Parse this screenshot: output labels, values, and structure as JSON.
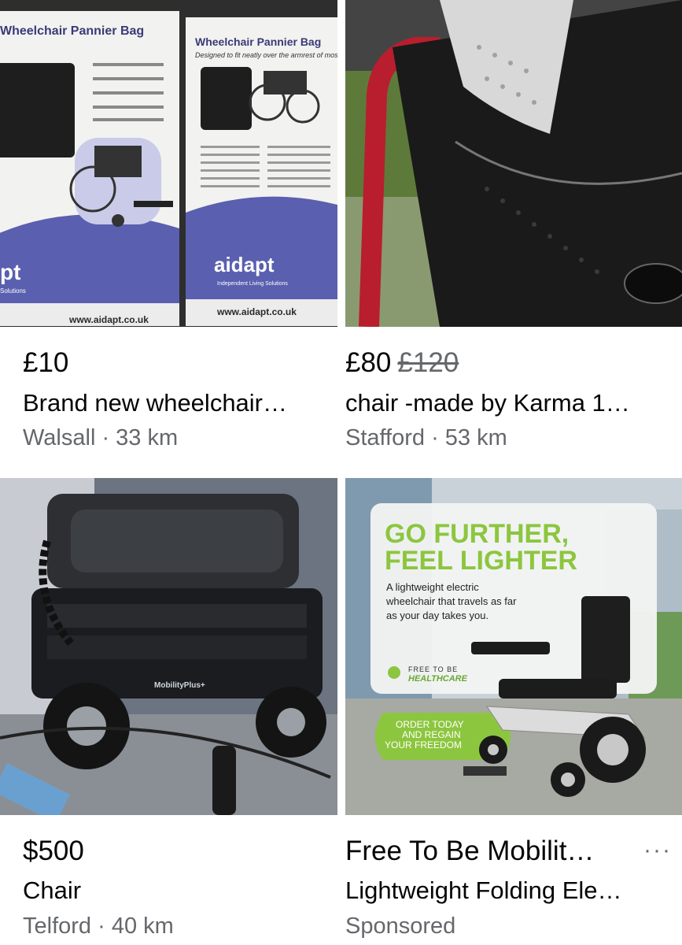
{
  "listings": [
    {
      "price": "£10",
      "title": "Brand new wheelchair…",
      "subtitle": "Walsall · 33 km",
      "box": {
        "heading": "Wheelchair Pannier Bag",
        "tagline": "Designed to fit neatly over the armrest of most wheelchairs",
        "brand": "aidapt",
        "brand_sub": "Independent Living Solutions",
        "url": "www.aidapt.co.uk",
        "partial_brand": "pt",
        "partial_sub": "Solutions"
      }
    },
    {
      "price": "£80",
      "old_price": "£120",
      "title": "chair -made by Karma 1…",
      "subtitle": "Stafford · 53 km"
    },
    {
      "price": "$500",
      "title": "Chair",
      "subtitle": "Telford · 40 km",
      "scooter_brand": "MobilityPlus+"
    },
    {
      "price": "Free To Be Mobilit…",
      "title": "Lightweight Folding Ele…",
      "subtitle": "Sponsored",
      "more": "···",
      "ad": {
        "headline_1": "GO FURTHER,",
        "headline_2": "FEEL LIGHTER",
        "body_1": "A lightweight electric",
        "body_2": "wheelchair that travels as far",
        "body_3": "as your day takes you.",
        "logo_1": "FREE TO BE",
        "logo_2": "HEALTHCARE",
        "cta_1": "ORDER TODAY",
        "cta_2": "AND REGAIN",
        "cta_3": "YOUR FREEDOM"
      }
    }
  ]
}
